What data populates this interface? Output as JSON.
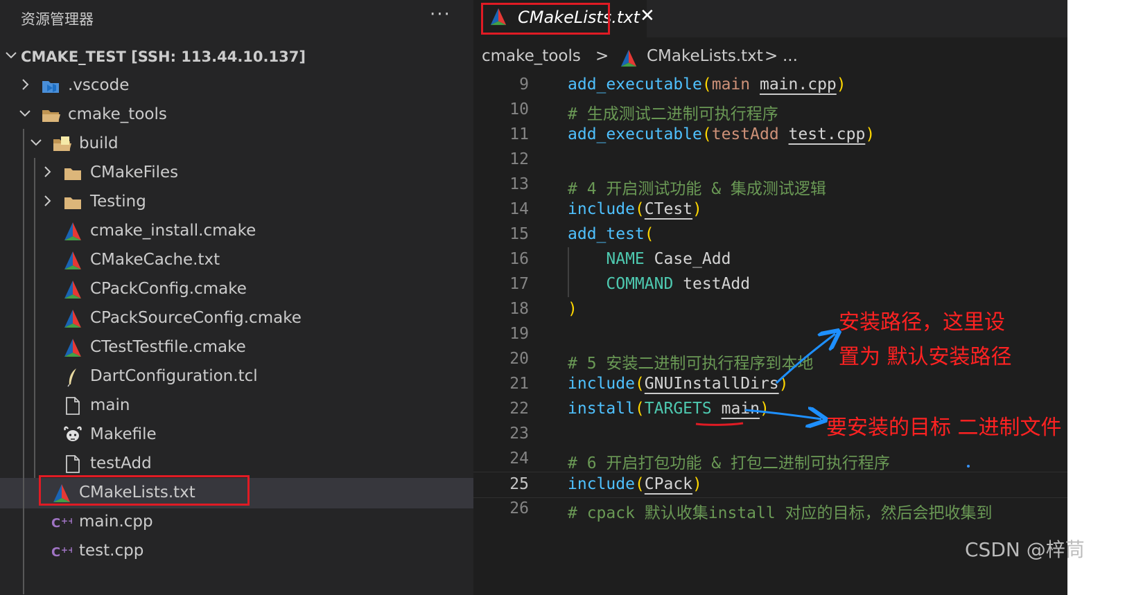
{
  "explorer": {
    "title": "资源管理器",
    "more_label": "···",
    "root_label": "CMAKE_TEST [SSH: 113.44.10.137]",
    "items": [
      {
        "label": ".vscode"
      },
      {
        "label": "cmake_tools"
      },
      {
        "label": "build"
      },
      {
        "label": "CMakeFiles"
      },
      {
        "label": "Testing"
      },
      {
        "label": "cmake_install.cmake"
      },
      {
        "label": "CMakeCache.txt"
      },
      {
        "label": "CPackConfig.cmake"
      },
      {
        "label": "CPackSourceConfig.cmake"
      },
      {
        "label": "CTestTestfile.cmake"
      },
      {
        "label": "DartConfiguration.tcl"
      },
      {
        "label": "main"
      },
      {
        "label": "Makefile"
      },
      {
        "label": "testAdd"
      },
      {
        "label": "CMakeLists.txt"
      },
      {
        "label": "main.cpp"
      },
      {
        "label": "test.cpp"
      }
    ]
  },
  "editor": {
    "tab_label": "CMakeLists.txt",
    "tab_close": "✕",
    "breadcrumb": {
      "folder": "cmake_tools",
      "sep": ">",
      "file": "CMakeLists.txt",
      "sep2": ">",
      "more": "..."
    },
    "line_numbers": [
      "9",
      "10",
      "11",
      "12",
      "13",
      "14",
      "15",
      "16",
      "17",
      "18",
      "19",
      "20",
      "21",
      "22",
      "23",
      "24",
      "25",
      "26"
    ],
    "lines": {
      "l9": {
        "fn": "add_executable",
        "open": "(",
        "a": "main",
        "b": "main.cpp",
        "close": ")"
      },
      "l10": {
        "comment": "# 生成测试二进制可执行程序"
      },
      "l11": {
        "fn": "add_executable",
        "open": "(",
        "a": "testAdd",
        "b": "test.cpp",
        "close": ")"
      },
      "l13": {
        "comment": "# 4 开启测试功能 & 集成测试逻辑"
      },
      "l14": {
        "fn": "include",
        "open": "(",
        "a": "CTest",
        "close": ")"
      },
      "l15": {
        "fn": "add_test",
        "open": "("
      },
      "l16": {
        "kw": "NAME",
        "val": "Case_Add"
      },
      "l17": {
        "kw": "COMMAND",
        "val": "testAdd"
      },
      "l18": {
        "close": ")"
      },
      "l20": {
        "comment": "# 5 安装二进制可执行程序到本地"
      },
      "l21": {
        "fn": "include",
        "open": "(",
        "a": "GNUInstallDirs",
        "close": ")"
      },
      "l22": {
        "fn": "install",
        "open": "(",
        "kw": "TARGETS",
        "a": "main",
        "close": ")"
      },
      "l24": {
        "comment": "# 6 开启打包功能 & 打包二进制可执行程序"
      },
      "l25": {
        "fn": "include",
        "open": "(",
        "a": "CPack",
        "close": ")"
      },
      "l26": {
        "comment": "# cpack 默认收集install 对应的目标，然后会把收集到"
      }
    }
  },
  "annotations": {
    "install_path_line1": "安装路径，这里设",
    "install_path_line2": "置为 默认安装路径",
    "install_target": "要安装的目标 二进制文件",
    "red": "#ff2222",
    "blue": "#1e90ff"
  },
  "watermark": "CSDN @梓茼",
  "colors": {
    "sidebar_bg": "#252526",
    "editor_bg": "#1e1e1e",
    "selected_row": "#37373d",
    "function": "#4fc1ff",
    "comment": "#6a9955",
    "string_arg": "#ce9178",
    "target_kw": "#4ec9b0",
    "paren": "#ffd700",
    "highlight_box": "#e01b24"
  }
}
